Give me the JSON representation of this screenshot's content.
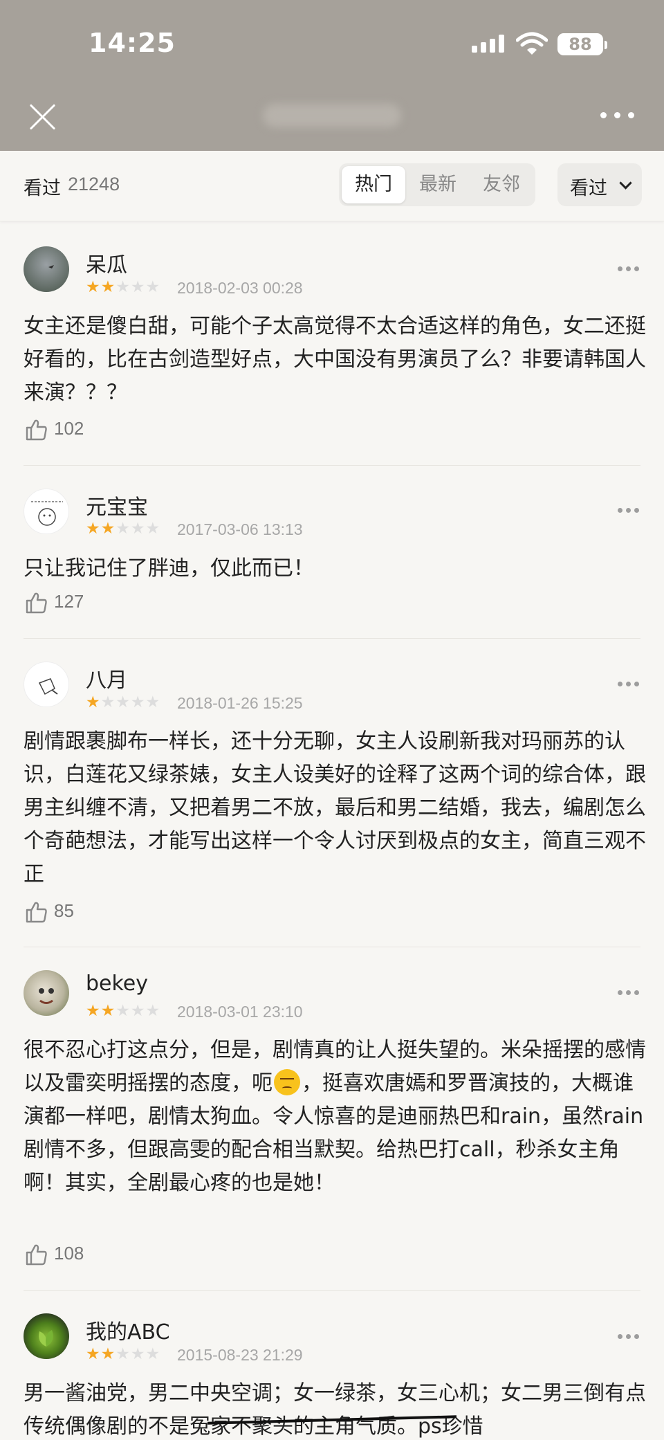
{
  "status": {
    "time": "14:25",
    "battery": "88"
  },
  "subheader": {
    "seen_label": "看过",
    "seen_count": "21248",
    "tabs": [
      {
        "label": "热门",
        "active": true
      },
      {
        "label": "最新",
        "active": false
      },
      {
        "label": "友邻",
        "active": false
      }
    ],
    "filter_label": "看过"
  },
  "reviews": [
    {
      "username": "呆瓜",
      "rating": 2,
      "date": "2018-02-03 00:28",
      "text": "女主还是傻白甜，可能个子太高觉得不太合适这样的角色，女二还挺好看的，比在古剑造型好点，大中国没有男演员了么？非要请韩国人来演？？？",
      "likes": "102"
    },
    {
      "username": "元宝宝",
      "rating": 2,
      "date": "2017-03-06 13:13",
      "text": "只让我记住了胖迪，仅此而已！",
      "likes": "127"
    },
    {
      "username": "八月",
      "rating": 1,
      "date": "2018-01-26 15:25",
      "text": "剧情跟裹脚布一样长，还十分无聊，女主人设刷新我对玛丽苏的认识，白莲花又绿茶婊，女主人设美好的诠释了这两个词的综合体，跟男主纠缠不清，又把着男二不放，最后和男二结婚，我去，编剧怎么个奇葩想法，才能写出这样一个令人讨厌到极点的女主，简直三观不正",
      "likes": "85"
    },
    {
      "username": "bekey",
      "rating": 2,
      "date": "2018-03-01 23:10",
      "text_before_emoji": "很不忍心打这点分，但是，剧情真的让人挺失望的。米朵摇摆的感情以及雷奕明摇摆的态度，呃",
      "text_after_emoji": "，挺喜欢唐嫣和罗晋演技的，大概谁演都一样吧，剧情太狗血。令人惊喜的是迪丽热巴和rain，虽然rain剧情不多，但跟高雯的配合相当默契。给热巴打call，秒杀女主角啊！其实，全剧最心疼的也是她！",
      "likes": "108"
    },
    {
      "username": "我的ABC",
      "rating": 2,
      "date": "2015-08-23 21:29",
      "text": "男一酱油党，男二中央空调；女一绿茶，女三心机；女二男三倒有点传统偶像剧的不是冤家不聚头的主角气质。ps珍惜",
      "likes": ""
    }
  ]
}
